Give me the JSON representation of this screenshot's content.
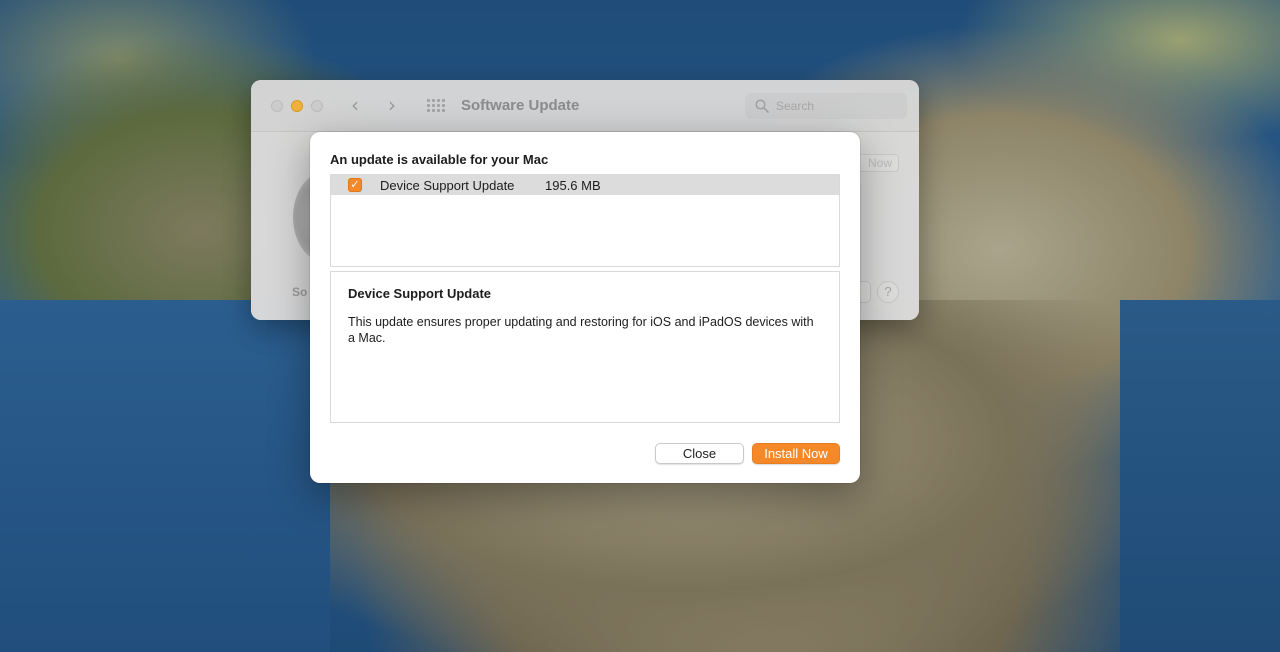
{
  "window": {
    "title": "Software Update",
    "search_placeholder": "Search",
    "partial_button_label": "Now",
    "help_label": "?",
    "partial_left_label": "So"
  },
  "sheet": {
    "heading": "An update is available for your Mac",
    "updates": [
      {
        "name": "Device Support Update",
        "size": "195.6 MB",
        "checked": true
      }
    ],
    "detail": {
      "title": "Device Support Update",
      "description": "This update ensures proper updating and restoring for iOS and iPadOS devices with a Mac."
    },
    "buttons": {
      "close_label": "Close",
      "install_label": "Install Now"
    }
  },
  "icons": {
    "checkbox_glyph": "✓",
    "back_glyph": "‹",
    "forward_glyph": "›"
  },
  "colors": {
    "accent": "#f5892a",
    "window_bg": "#dcdcdc",
    "minimize": "#f5b23a"
  }
}
